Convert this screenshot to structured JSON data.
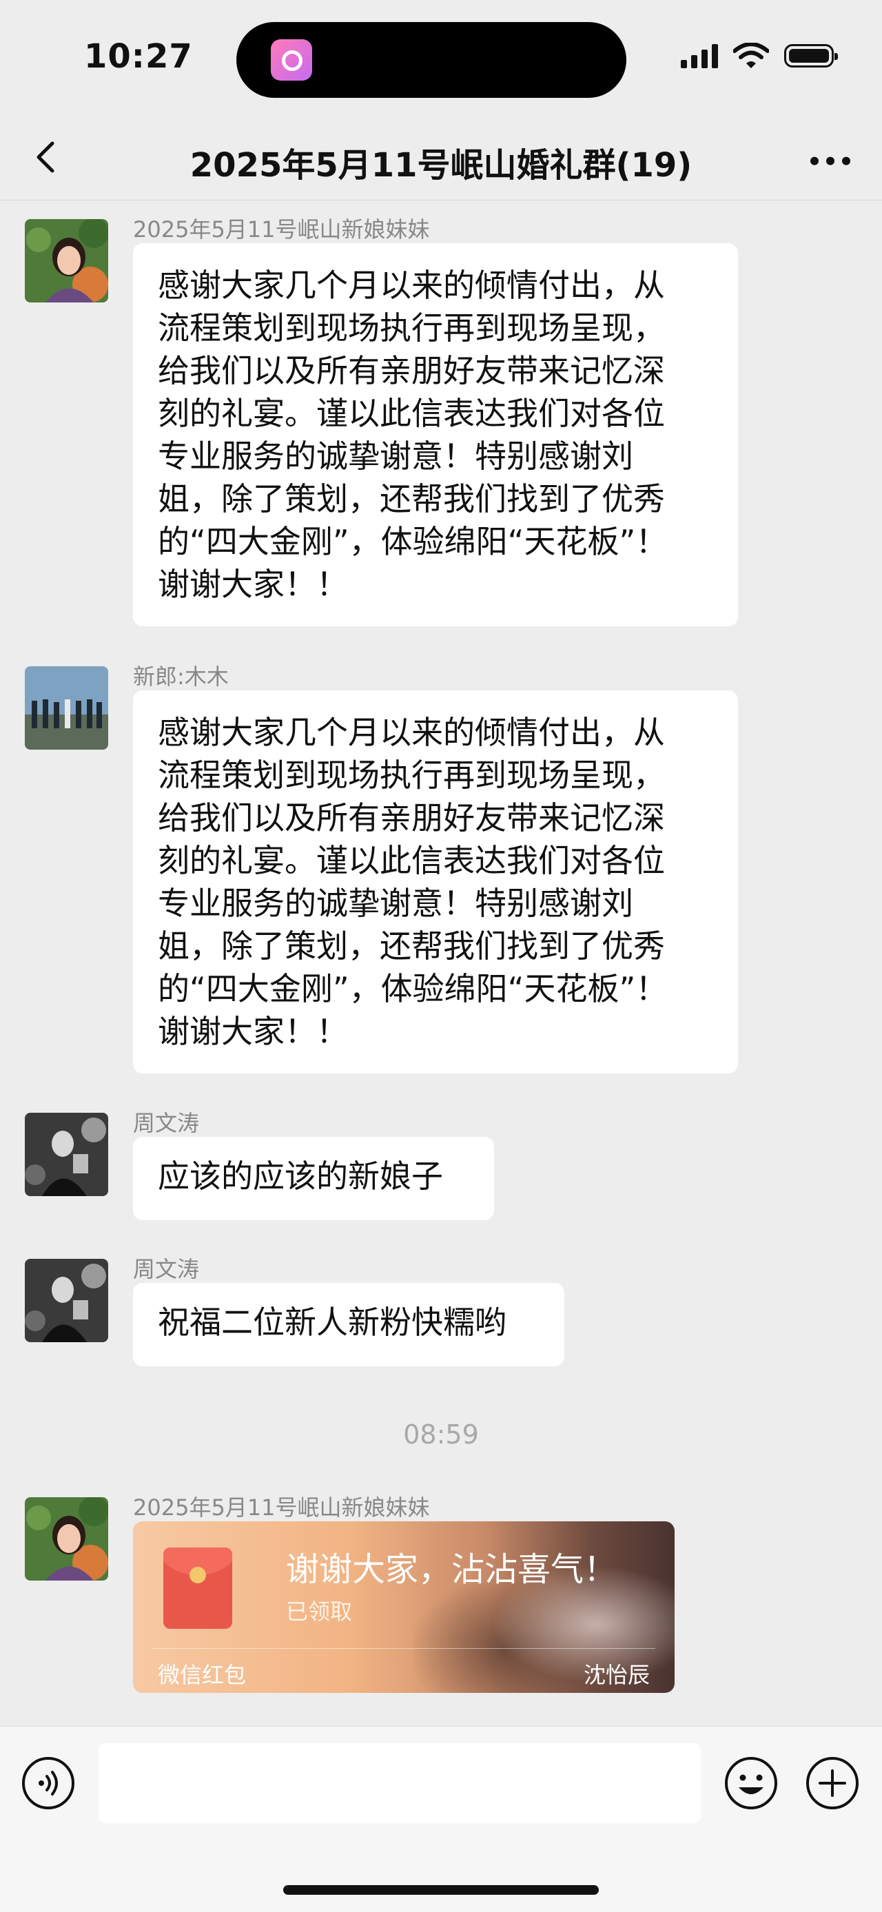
{
  "status_bar": {
    "time": "10:27"
  },
  "nav": {
    "title": "2025年5月11号岷山婚礼群(19)"
  },
  "messages": [
    {
      "sender": "2025年5月11号岷山新娘妹妹",
      "lines": [
        "感谢大家几个月以来的倾情付出，从",
        "流程策划到现场执行再到现场呈现，",
        "给我们以及所有亲朋好友带来记忆深",
        "刻的礼宴。谨以此信表达我们对各位",
        "专业服务的诚挚谢意！特别感谢刘",
        "姐，除了策划，还帮我们找到了优秀",
        "的“四大金刚”，体验绵阳“天花板”！",
        "谢谢大家！！"
      ]
    },
    {
      "sender": "新郎:木木",
      "lines": [
        "感谢大家几个月以来的倾情付出，从",
        "流程策划到现场执行再到现场呈现，",
        "给我们以及所有亲朋好友带来记忆深",
        "刻的礼宴。谨以此信表达我们对各位",
        "专业服务的诚挚谢意！特别感谢刘",
        "姐，除了策划，还帮我们找到了优秀",
        "的“四大金刚”，体验绵阳“天花板”！",
        "谢谢大家！！"
      ]
    },
    {
      "sender": "周文涛",
      "text": "应该的应该的新娘子"
    },
    {
      "sender": "周文涛",
      "text": "祝福二位新人新粉快糯哟"
    }
  ],
  "timestamp": "08:59",
  "red_packet_message": {
    "sender": "2025年5月11号岷山新娘妹妹",
    "title": "谢谢大家，沾沾喜气！",
    "status": "已领取",
    "footer_left": "微信红包",
    "footer_right": "沈怡辰"
  },
  "colors": {
    "background": "#ededed",
    "bubble": "#ffffff",
    "red_packet": "#f2b484"
  },
  "icons": {
    "back": "chevron-left-icon",
    "more": "more-dots-icon",
    "voice": "voice-icon",
    "emoji": "emoji-icon",
    "plus": "plus-icon"
  }
}
